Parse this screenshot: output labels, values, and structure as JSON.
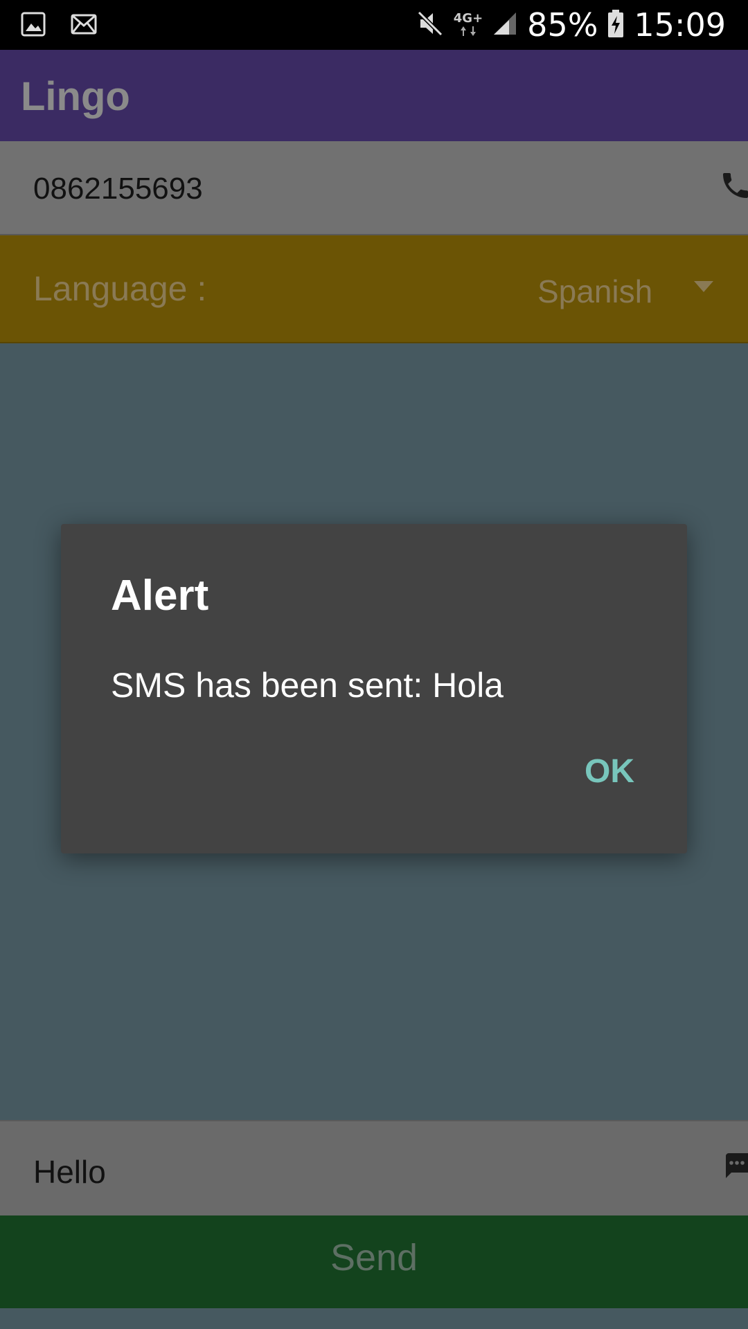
{
  "status_bar": {
    "left_icons": [
      "image-icon",
      "mail-icon"
    ],
    "right_icons": [
      "mute-icon",
      "network-4g-icon",
      "signal-icon",
      "battery-charging-icon"
    ],
    "network_label": "4G+",
    "battery": "85%",
    "time": "15:09"
  },
  "app_bar": {
    "title": "Lingo"
  },
  "phone": {
    "value": "0862155693",
    "icon": "phone-icon"
  },
  "language": {
    "label": "Language :",
    "selected": "Spanish",
    "icon": "dropdown-arrow-icon"
  },
  "dialog": {
    "title": "Alert",
    "message": "SMS has been sent: Hola",
    "ok_label": "OK"
  },
  "message": {
    "value": "Hello",
    "icon": "message-icon"
  },
  "send_button": {
    "label": "Send"
  },
  "colors": {
    "app_bar": "#3b2b63",
    "language_bar": "#6b5405",
    "send_button": "#13431d",
    "dialog": "#434343",
    "ok_accent": "#78c6bc"
  }
}
